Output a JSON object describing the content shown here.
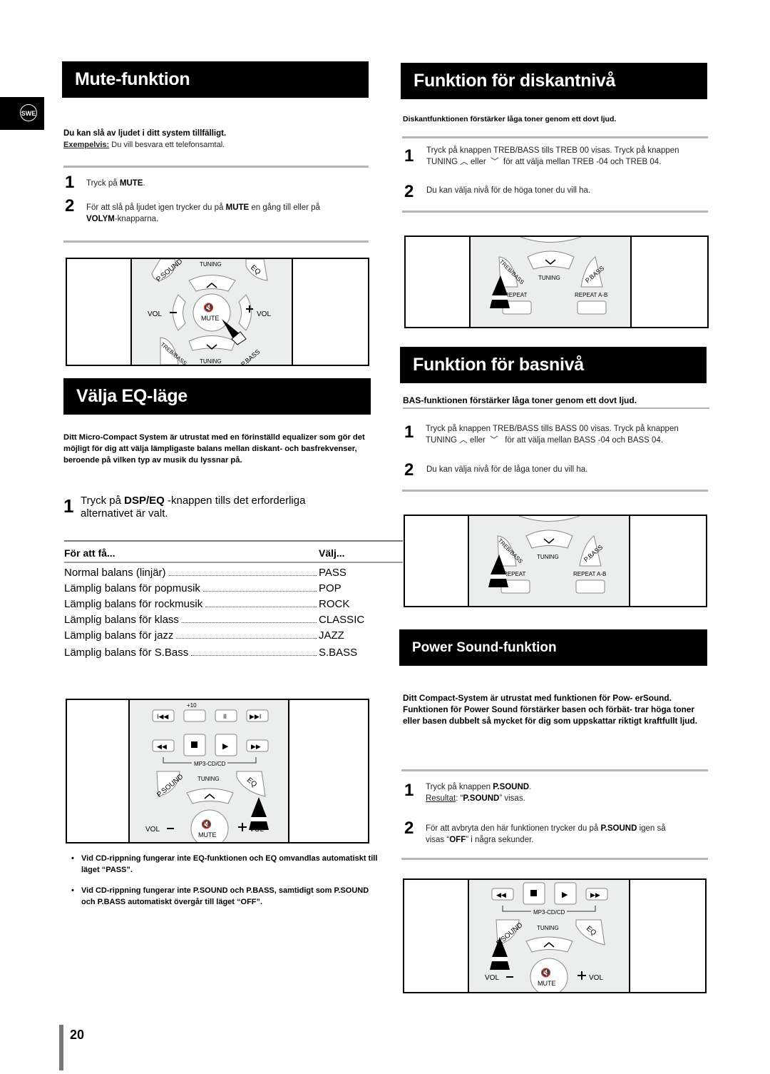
{
  "language_tab": "SWE",
  "page_number": "20",
  "mute": {
    "title": "Mute-funktion",
    "lead": "Du kan slå av ljudet i ditt system tillfälligt.",
    "example_label": "Exempelvis:",
    "example_text": " Du vill besvara ett telefonsamtal.",
    "steps": [
      {
        "num": "1",
        "pre": "Tryck på ",
        "bold": "MUTE",
        "post": "."
      },
      {
        "num": "2",
        "pre": "För att slå på ljudet igen trycker du på ",
        "bold": "MUTE",
        "mid": " en gång till eller på ",
        "bold2": "VOLYM",
        "post": "-knapparna."
      }
    ],
    "figure_labels": {
      "psound": "P.SOUND",
      "tuning": "TUNING",
      "eq": "EQ",
      "vol": "VOL",
      "mute": "MUTE",
      "treb_bass": "TREB/BASS",
      "pbass": "P.BASS"
    }
  },
  "eq": {
    "title": "Välja EQ-läge",
    "lead": "Ditt Micro-Compact System är utrustat med en förinställd equalizer som gör det möjligt för dig att välja lämpligaste balans mellan diskant- och basfrekvenser, beroende på vilken typ av musik du lyssnar på.",
    "step": {
      "num": "1",
      "pre": "Tryck på ",
      "bold": "DSP/EQ",
      "post": "  -knappen tills det erforderliga alternativet är valt."
    },
    "table": {
      "headers": [
        "För att få...",
        "Välj..."
      ],
      "rows": [
        [
          "Normal balans (linjär)",
          "PASS"
        ],
        [
          "Lämplig balans för popmusik",
          "POP"
        ],
        [
          "Lämplig balans för rockmusik",
          "ROCK"
        ],
        [
          "Lämplig balans för klass",
          "CLASSIC"
        ],
        [
          "Lämplig balans för jazz",
          "JAZZ"
        ],
        [
          "Lämplig balans för S.Bass",
          "S.BASS"
        ]
      ]
    },
    "figure_labels": {
      "plus10": "+10",
      "mp3cd": "MP3-CD/CD",
      "psound": "P.SOUND",
      "tuning": "TUNING",
      "eq": "EQ",
      "vol": "VOL",
      "mute": "MUTE"
    },
    "notes": [
      "Vid CD-rippning fungerar inte EQ-funktionen och EQ omvandlas automatiskt till läget “PASS”.",
      "Vid CD-rippning fungerar inte P.SOUND och P.BASS, samtidigt som P.SOUND och P.BASS automatiskt övergår till läget “OFF”."
    ]
  },
  "treble": {
    "title": "Funktion för diskantnivå",
    "lead": "Diskantfunktionen förstärker låga toner genom ett dovt ljud.",
    "steps": [
      {
        "num": "1",
        "line1": "Tryck på knappen TREB/BASS tills TREB 00 visas. Tryck på knappen",
        "line2_pre": "TUNING",
        "line2_mid": "eller",
        "line2_post": "för att välja mellan TREB -04 och TREB 04."
      },
      {
        "num": "2",
        "text": "Du kan välja nivå för de höga toner du vill ha."
      }
    ],
    "figure_labels": {
      "treb_bass": "TREB/BASS",
      "tuning": "TUNING",
      "pbass": "P.BASS",
      "repeat": "REPEAT",
      "repeat_ab": "REPEAT A-B"
    }
  },
  "bass": {
    "title": "Funktion för basnivå",
    "lead": "BAS-funktionen förstärker låga toner genom ett dovt ljud.",
    "steps": [
      {
        "num": "1",
        "line1": "Tryck på knappen TREB/BASS tills BASS 00 visas.  Tryck på knappen",
        "line2_pre": "TUNING",
        "line2_mid": "eller",
        "line2_post": "för att välja mellan BASS -04 och BASS 04."
      },
      {
        "num": "2",
        "text": "Du kan välja nivå för de låga toner du vill ha."
      }
    ],
    "figure_labels": {
      "treb_bass": "TREB/BASS",
      "tuning": "TUNING",
      "pbass": "P.BASS",
      "repeat": "REPEAT",
      "repeat_ab": "REPEAT A-B"
    }
  },
  "power_sound": {
    "title": "Power Sound-funktion",
    "lead1": "Ditt Compact-System är utrustat med funktionen för Pow- erSound.",
    "lead2": "Funktionen för Power Sound förstärker basen och förbät- trar höga toner eller basen dubbelt så mycket för dig som uppskattar riktigt kraftfullt ljud.",
    "steps": [
      {
        "num": "1",
        "pre": "Tryck på knappen ",
        "bold": "P.SOUND",
        "post": ".",
        "result_label": "Resultat",
        "result_pre": ": “",
        "result_bold": "P.SOUND",
        "result_post": "” visas."
      },
      {
        "num": "2",
        "pre": "För att avbryta den här funktionen trycker du på ",
        "bold": "P.SOUND",
        "post": " igen så",
        "line2_pre": "visas “",
        "line2_bold": "OFF",
        "line2_post": "” i några sekunder."
      }
    ],
    "figure_labels": {
      "mp3cd": "MP3-CD/CD",
      "psound": "P.SOUND",
      "tuning": "TUNING",
      "eq": "EQ",
      "vol": "VOL",
      "mute": "MUTE"
    }
  }
}
